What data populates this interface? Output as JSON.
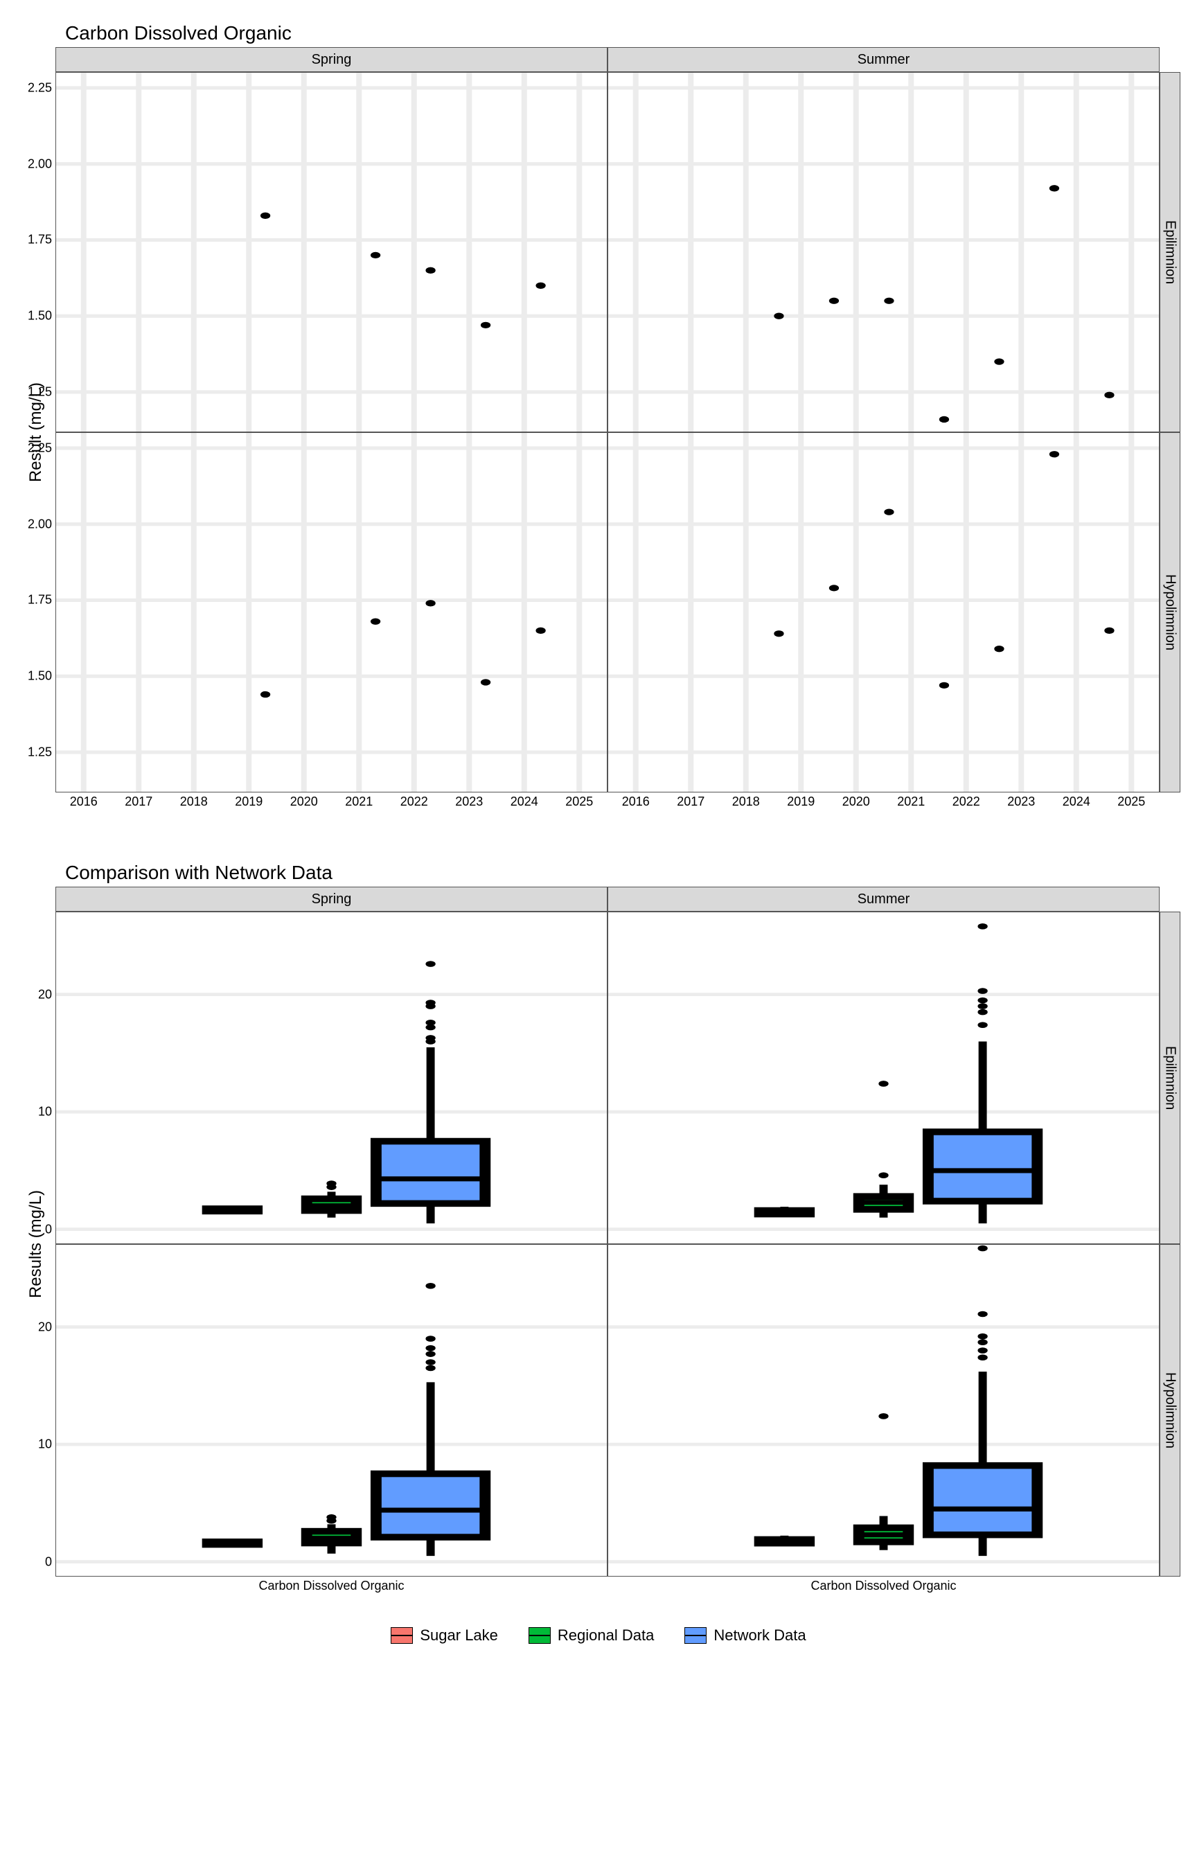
{
  "chart_data": [
    {
      "id": "scatter",
      "type": "scatter",
      "title": "Carbon Dissolved Organic",
      "ylabel": "Result (mg/L)",
      "cols": [
        "Spring",
        "Summer"
      ],
      "rows": [
        "Epilimnion",
        "Hypolimnion"
      ],
      "xlim": [
        2015.5,
        2025.5
      ],
      "ylim": [
        1.12,
        2.3
      ],
      "xticks": [
        2016,
        2017,
        2018,
        2019,
        2020,
        2021,
        2022,
        2023,
        2024,
        2025
      ],
      "yticks": [
        1.25,
        1.5,
        1.75,
        2.0,
        2.25
      ],
      "panels": {
        "Spring|Epilimnion": [
          {
            "x": 2019.3,
            "y": 1.83
          },
          {
            "x": 2021.3,
            "y": 1.7
          },
          {
            "x": 2022.3,
            "y": 1.65
          },
          {
            "x": 2023.3,
            "y": 1.47
          },
          {
            "x": 2024.3,
            "y": 1.6
          }
        ],
        "Summer|Epilimnion": [
          {
            "x": 2018.6,
            "y": 1.5
          },
          {
            "x": 2019.6,
            "y": 1.55
          },
          {
            "x": 2020.6,
            "y": 1.55
          },
          {
            "x": 2021.6,
            "y": 1.16
          },
          {
            "x": 2022.6,
            "y": 1.35
          },
          {
            "x": 2023.6,
            "y": 1.92
          },
          {
            "x": 2024.6,
            "y": 1.24
          }
        ],
        "Spring|Hypolimnion": [
          {
            "x": 2019.3,
            "y": 1.44
          },
          {
            "x": 2021.3,
            "y": 1.68
          },
          {
            "x": 2022.3,
            "y": 1.74
          },
          {
            "x": 2023.3,
            "y": 1.48
          },
          {
            "x": 2024.3,
            "y": 1.65
          }
        ],
        "Summer|Hypolimnion": [
          {
            "x": 2018.6,
            "y": 1.64
          },
          {
            "x": 2019.6,
            "y": 1.79
          },
          {
            "x": 2020.6,
            "y": 2.04
          },
          {
            "x": 2021.6,
            "y": 1.47
          },
          {
            "x": 2022.6,
            "y": 1.59
          },
          {
            "x": 2023.6,
            "y": 2.23
          },
          {
            "x": 2024.6,
            "y": 1.65
          }
        ]
      }
    },
    {
      "id": "box",
      "type": "boxplot",
      "title": "Comparison with Network Data",
      "ylabel": "Results (mg/L)",
      "cols": [
        "Spring",
        "Summer"
      ],
      "rows": [
        "Epilimnion",
        "Hypolimnion"
      ],
      "ylim": [
        -1.2,
        27
      ],
      "yticks": [
        0,
        10,
        20
      ],
      "xcat": "Carbon Dissolved Organic",
      "series": [
        {
          "name": "Sugar Lake",
          "color": "#F8766D"
        },
        {
          "name": "Regional Data",
          "color": "#00BA38"
        },
        {
          "name": "Network Data",
          "color": "#619CFF"
        }
      ],
      "panels": {
        "Spring|Epilimnion": [
          {
            "series": "Sugar Lake",
            "min": 1.47,
            "q1": 1.55,
            "med": 1.65,
            "q3": 1.75,
            "max": 1.83,
            "out": []
          },
          {
            "series": "Regional Data",
            "min": 1.0,
            "q1": 1.6,
            "med": 2.0,
            "q3": 2.6,
            "max": 3.2,
            "out": [
              3.6,
              3.9
            ]
          },
          {
            "series": "Network Data",
            "min": 0.5,
            "q1": 2.2,
            "med": 4.3,
            "q3": 7.5,
            "max": 15.5,
            "out": [
              16.0,
              16.3,
              17.2,
              17.6,
              19.0,
              19.3,
              22.6
            ]
          }
        ],
        "Summer|Epilimnion": [
          {
            "series": "Sugar Lake",
            "min": 1.16,
            "q1": 1.3,
            "med": 1.5,
            "q3": 1.6,
            "max": 1.92,
            "out": []
          },
          {
            "series": "Regional Data",
            "min": 1.0,
            "q1": 1.7,
            "med": 2.3,
            "q3": 2.8,
            "max": 3.8,
            "out": [
              4.6,
              12.4
            ]
          },
          {
            "series": "Network Data",
            "min": 0.5,
            "q1": 2.4,
            "med": 5.0,
            "q3": 8.3,
            "max": 16.0,
            "out": [
              17.4,
              18.5,
              19.0,
              19.5,
              20.3,
              25.8
            ]
          }
        ],
        "Spring|Hypolimnion": [
          {
            "series": "Sugar Lake",
            "min": 1.44,
            "q1": 1.48,
            "med": 1.65,
            "q3": 1.7,
            "max": 1.74,
            "out": []
          },
          {
            "series": "Regional Data",
            "min": 0.7,
            "q1": 1.6,
            "med": 2.0,
            "q3": 2.6,
            "max": 3.2,
            "out": [
              3.5,
              3.8
            ]
          },
          {
            "series": "Network Data",
            "min": 0.5,
            "q1": 2.1,
            "med": 4.4,
            "q3": 7.5,
            "max": 15.3,
            "out": [
              16.5,
              17.0,
              17.7,
              18.2,
              19.0,
              23.5
            ]
          }
        ],
        "Summer|Hypolimnion": [
          {
            "series": "Sugar Lake",
            "min": 1.47,
            "q1": 1.59,
            "med": 1.65,
            "q3": 1.9,
            "max": 2.23,
            "out": []
          },
          {
            "series": "Regional Data",
            "min": 1.0,
            "q1": 1.7,
            "med": 2.3,
            "q3": 2.9,
            "max": 3.9,
            "out": [
              12.4
            ]
          },
          {
            "series": "Network Data",
            "min": 0.5,
            "q1": 2.3,
            "med": 4.5,
            "q3": 8.2,
            "max": 16.2,
            "out": [
              17.4,
              18.0,
              18.7,
              19.2,
              21.1,
              26.7
            ]
          }
        ]
      }
    }
  ],
  "legend": {
    "items": [
      "Sugar Lake",
      "Regional Data",
      "Network Data"
    ],
    "colors": {
      "Sugar Lake": "#F8766D",
      "Regional Data": "#00BA38",
      "Network Data": "#619CFF"
    }
  }
}
